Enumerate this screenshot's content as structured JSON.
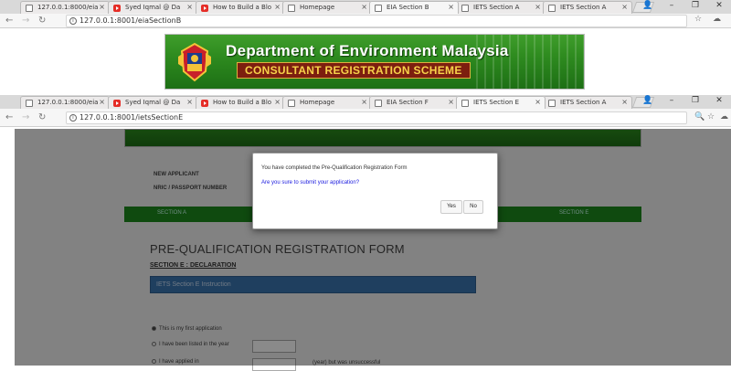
{
  "window_back": {
    "tabs": [
      {
        "label": "127.0.0.1:8000/eia",
        "icon": "doc"
      },
      {
        "label": "Syed Iqmal @ Da",
        "icon": "youtube"
      },
      {
        "label": "How to Build a Blo",
        "icon": "youtube"
      },
      {
        "label": "Homepage",
        "icon": "doc"
      },
      {
        "label": "EIA Section B",
        "icon": "doc",
        "active": true
      },
      {
        "label": "IETS Section A",
        "icon": "doc"
      },
      {
        "label": "IETS Section A",
        "icon": "doc"
      }
    ],
    "url": "127.0.0.1:8001/eiaSectionB",
    "banner_title": "Department of Environment Malaysia",
    "banner_subtitle": "CONSULTANT REGISTRATION SCHEME"
  },
  "window_front": {
    "tabs": [
      {
        "label": "127.0.0.1:8000/eia",
        "icon": "doc"
      },
      {
        "label": "Syed Iqmal @ Da",
        "icon": "youtube"
      },
      {
        "label": "How to Build a Blo",
        "icon": "youtube"
      },
      {
        "label": "Homepage",
        "icon": "doc"
      },
      {
        "label": "EIA Section F",
        "icon": "doc"
      },
      {
        "label": "IETS Section E",
        "icon": "doc",
        "active": true
      },
      {
        "label": "IETS Section A",
        "icon": "doc"
      }
    ],
    "url": "127.0.0.1:8001/ietsSectionE"
  },
  "page": {
    "new_applicant_label": "NEW APPLICANT",
    "nric_label": "NRIC / PASSPORT NUMBER",
    "section_a": "SECTION A",
    "section_e": "SECTION E",
    "form_title": "PRE-QUALIFICATION REGISTRATION FORM",
    "section_link": "SECTION E : DECLARATION",
    "instruction_header": "IETS Section E Instruction",
    "radio_first": "This is my first application",
    "radio_listed": "I have been listed in the year",
    "radio_applied": "I have applied in",
    "radio_applied_suffix": "(year) but was unsuccessful"
  },
  "modal": {
    "message": "You have completed the Pre-Qualification Registration Form",
    "question": "Are you sure to submit your application?",
    "yes_label": "Yes",
    "no_label": "No"
  }
}
